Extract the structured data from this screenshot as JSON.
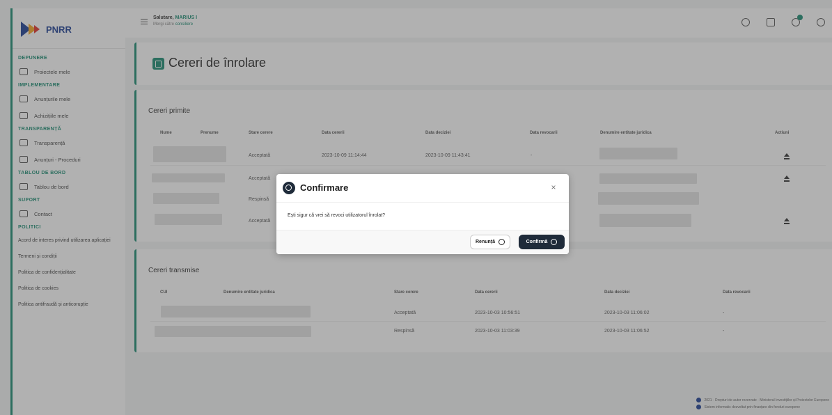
{
  "sidebar": {
    "logo_text": "PNRR",
    "sections": [
      {
        "title": "DEPUNERE",
        "items": [
          "Proiectele mele"
        ]
      },
      {
        "title": "IMPLEMENTARE",
        "items": [
          "Anunțurile mele",
          "Achizițiile mele"
        ]
      },
      {
        "title": "TRANSPARENȚĂ",
        "items": [
          "Transparență",
          "Anunțuri - Proceduri"
        ]
      },
      {
        "title": "TABLOU DE BORD",
        "items": [
          "Tablou de bord"
        ]
      },
      {
        "title": "SUPORT",
        "items": [
          "Contact"
        ]
      },
      {
        "title": "POLITICI",
        "links": [
          "Acord de interes privind utilizarea aplicației",
          "Termeni și condiții",
          "Politica de confidențialitate",
          "Politica de cookies",
          "Politica antifraudă și anticorupție"
        ]
      }
    ]
  },
  "topbar": {
    "greeting_prefix": "Salutare,",
    "user_name": "MARIUS I",
    "sub_prefix": "Mergi către",
    "sub_link": "consiliere"
  },
  "page": {
    "title": "Cereri de înrolare"
  },
  "received": {
    "title": "Cereri primite",
    "headers": [
      "Nume",
      "Prenume",
      "Stare cerere",
      "Data cererii",
      "Data deciziei",
      "Data revocarii",
      "Denumire entitate juridica",
      "Actiuni"
    ],
    "rows": [
      {
        "status": "Acceptată",
        "request_date": "2023-10-09 11:14:44",
        "decision_date": "2023-10-09 11:43:41",
        "revocation_date": "-"
      },
      {
        "status": "Acceptată",
        "request_date": "",
        "decision_date": "",
        "revocation_date": ""
      },
      {
        "status": "Respinsă",
        "request_date": "",
        "decision_date": "",
        "revocation_date": ""
      },
      {
        "status": "Acceptată",
        "request_date": "",
        "decision_date": "",
        "revocation_date": ""
      }
    ]
  },
  "sent": {
    "title": "Cereri transmise",
    "headers": [
      "CUI",
      "Denumire entitate juridica",
      "Stare cerere",
      "Data cererii",
      "Data deciziei",
      "Data revocarii"
    ],
    "rows": [
      {
        "status": "Acceptată",
        "request_date": "2023-10-03 10:56:51",
        "decision_date": "2023-10-03 11:06:02",
        "revocation_date": "-"
      },
      {
        "status": "Respinsă",
        "request_date": "2023-10-03 11:03:39",
        "decision_date": "2023-10-03 11:06:52",
        "revocation_date": "-"
      }
    ]
  },
  "footer": {
    "line1": "2021 · Drepturi de autor rezervate · Ministerul Investițiilor și Proiectelor Europene",
    "line2": "Sistem informatic dezvoltat prin finanțare din fonduri europene"
  },
  "modal": {
    "title": "Confirmare",
    "message": "Ești sigur că vrei să revoci utilizatorul înrolat?",
    "cancel_label": "Renunță",
    "confirm_label": "Confirmă",
    "close_glyph": "×"
  },
  "colors": {
    "accent": "#1a8c72",
    "brand_blue": "#1c3f94",
    "dark_button": "#1f2b3a"
  }
}
